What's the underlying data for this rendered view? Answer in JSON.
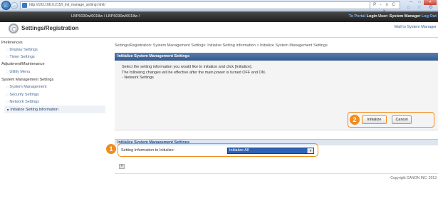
{
  "browser": {
    "url": "http://192.168.0.215/l_init_manage_setting.html/",
    "search_glyph": "P - ≡ C ×",
    "tool_glyphs": "⌂ ☆ ⚙"
  },
  "banner": {
    "device_name": "LBP6030w/6018w / LBP6030w/6018w /",
    "portal_link": "To Portal",
    "login_user": "Login User: System Manager",
    "logout_link": "Log Out"
  },
  "header": {
    "title": "Settings/Registration",
    "mail_link": "Mail to System Manager"
  },
  "sidebar": {
    "groups": [
      {
        "label": "Preferences"
      },
      {
        "label": "Adjustment/Maintenance"
      },
      {
        "label": "System Management Settings"
      }
    ],
    "items": [
      {
        "label": "Display Settings"
      },
      {
        "label": "Timer Settings"
      },
      {
        "label": "Utility Menu"
      },
      {
        "label": "System Management"
      },
      {
        "label": "Security Settings"
      },
      {
        "label": "Network Settings"
      },
      {
        "label": "Initialize Setting Information"
      }
    ]
  },
  "main": {
    "breadcrumb": "Settings/Registration: System Management Settings: Initialize Setting Information > Initialize System Management Settings",
    "panel_title": "Initialize System Management Settings",
    "description": [
      "Select the setting information you would like to initialize and click [Initialize].",
      "The following changes will be effective after the main power is turned OFF and ON.",
      "- Network Settings"
    ],
    "initialize_button": "Initialize",
    "cancel_button": "Cancel",
    "section_title": "Initialize System Management Settings",
    "field_label": "Setting Information to Initialize:",
    "field_value": "Initialize All",
    "top_glyph": "˄",
    "copyright": "Copyright CANON INC. 2013"
  },
  "callouts": [
    "1",
    "2"
  ],
  "colors": {
    "accent_callout": "#f08c1e",
    "panel_header": "#34598b",
    "select_bg": "#2f63b6"
  }
}
